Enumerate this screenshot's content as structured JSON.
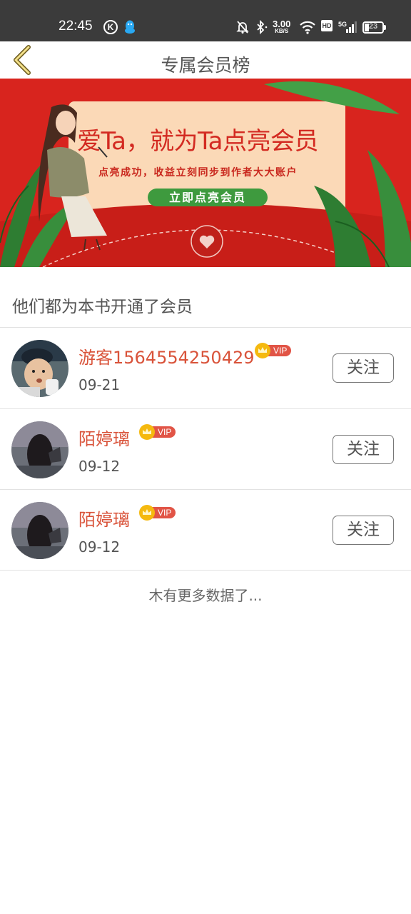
{
  "status_bar": {
    "time": "22:45",
    "k_label": "K",
    "speed_value": "3.00",
    "speed_unit": "KB/S",
    "hd_label": "HD",
    "network_label": "5G",
    "battery_level": "23",
    "icons": [
      "k-app-icon",
      "qq-penguin-icon",
      "mute-bell-icon",
      "bluetooth-icon",
      "wifi-icon",
      "hd-icon",
      "signal-5g-icon",
      "battery-icon"
    ]
  },
  "header": {
    "title": "专属会员榜",
    "back_icon": "chevron-left-icon"
  },
  "banner": {
    "title": "爱Ta，就为Ta点亮会员",
    "subtitle": "点亮成功，收益立刻同步到作者大大账户",
    "button_label": "立即点亮会员",
    "colors": {
      "background": "#d8241e",
      "card": "#fbd9b7",
      "button": "#3e9a3e"
    }
  },
  "section": {
    "heading": "他们都为本书开通了会员"
  },
  "members": [
    {
      "name": "游客1564554250429",
      "vip": "VIP",
      "date": "09-21",
      "follow_label": "关注",
      "avatar": "baby-photo"
    },
    {
      "name": "陌婷璃",
      "vip": "VIP",
      "date": "09-12",
      "follow_label": "关注",
      "avatar": "dark-portrait"
    },
    {
      "name": "陌婷璃",
      "vip": "VIP",
      "date": "09-12",
      "follow_label": "关注",
      "avatar": "dark-portrait"
    }
  ],
  "footer": {
    "no_more": "木有更多数据了..."
  },
  "colors": {
    "accent_name": "#d9533a",
    "vip_badge": "#e15446",
    "crown": "#f5b90f"
  }
}
